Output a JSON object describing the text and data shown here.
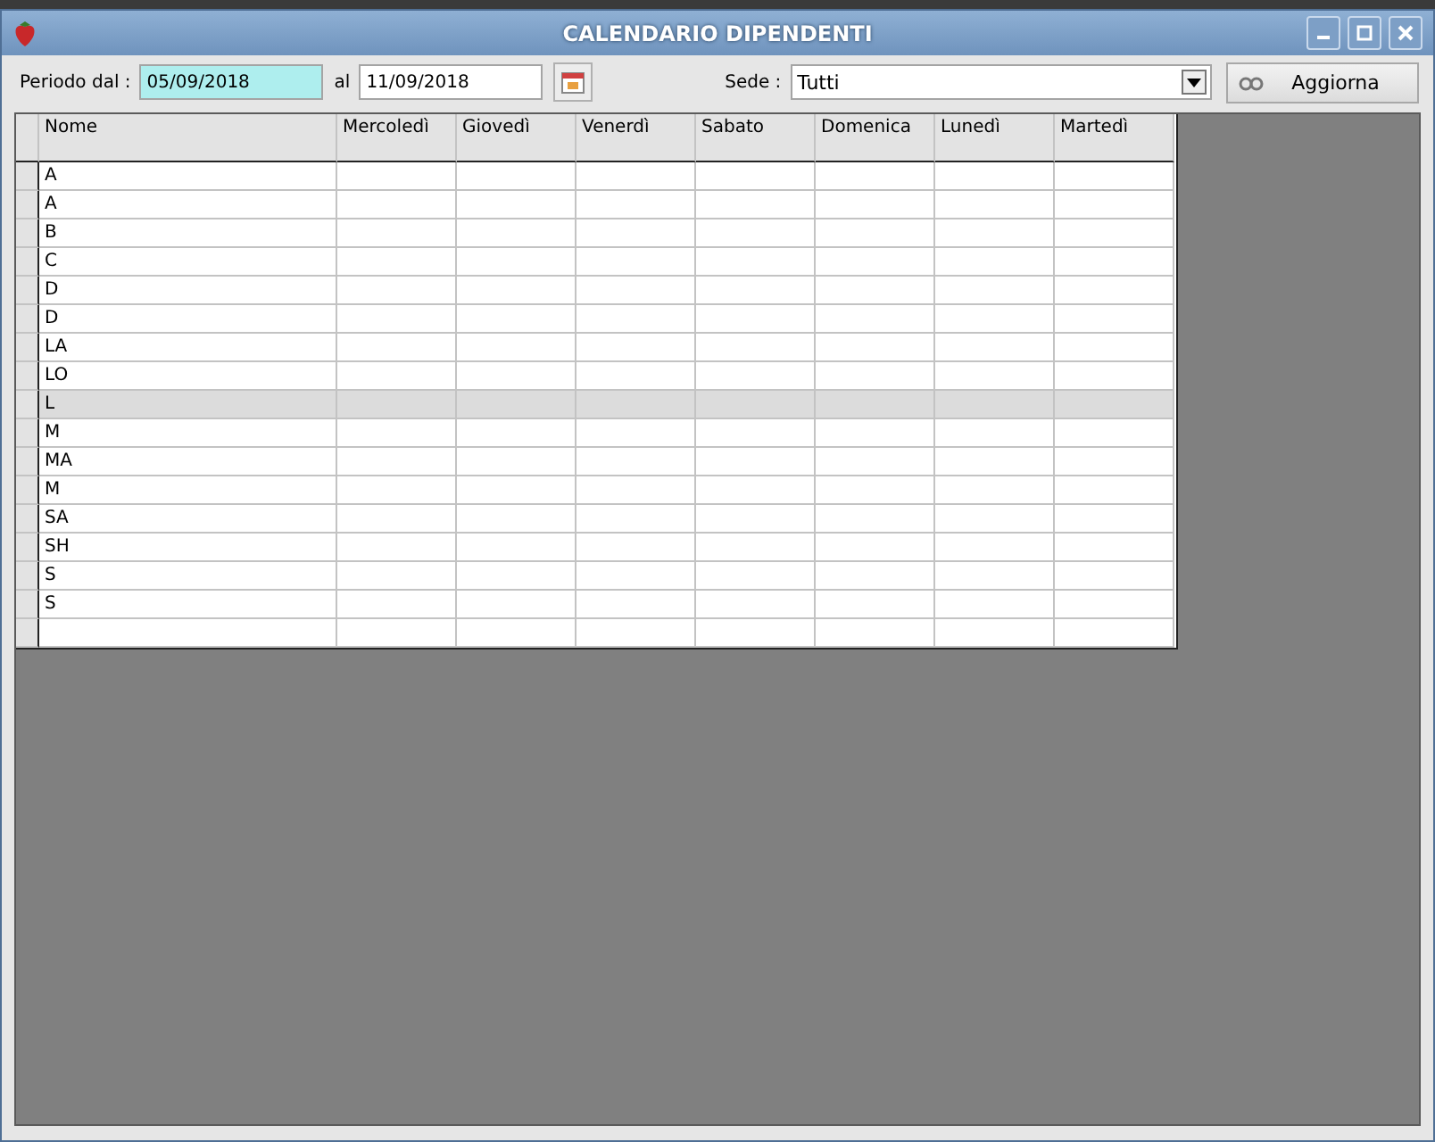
{
  "window": {
    "title": "CALENDARIO DIPENDENTI",
    "controls": [
      {
        "kind": "minimize"
      },
      {
        "kind": "maximize"
      },
      {
        "kind": "close"
      }
    ]
  },
  "filters": {
    "from_label": "Periodo dal :",
    "from_value": "05/09/2018",
    "to_label": "al",
    "to_value": "11/09/2018",
    "sede_label": "Sede :",
    "sede_value": "Tutti",
    "refresh_button": "Aggiorna"
  },
  "table": {
    "columns": [
      "Nome",
      "Mercoledì",
      "Giovedì",
      "Venerdì",
      "Sabato",
      "Domenica",
      "Lunedì",
      "Martedì"
    ],
    "rows": [
      {
        "name": "A",
        "selected": false
      },
      {
        "name": "A",
        "selected": false
      },
      {
        "name": "B",
        "selected": false
      },
      {
        "name": "C",
        "selected": false
      },
      {
        "name": "D",
        "selected": false
      },
      {
        "name": "D",
        "selected": false
      },
      {
        "name": "LA",
        "selected": false
      },
      {
        "name": "LO",
        "selected": false
      },
      {
        "name": "L",
        "selected": true
      },
      {
        "name": "M",
        "selected": false
      },
      {
        "name": "MA",
        "selected": false
      },
      {
        "name": "M",
        "selected": false
      },
      {
        "name": "SA",
        "selected": false
      },
      {
        "name": "SH",
        "selected": false
      },
      {
        "name": "S",
        "selected": false
      },
      {
        "name": "S",
        "selected": false
      }
    ]
  }
}
